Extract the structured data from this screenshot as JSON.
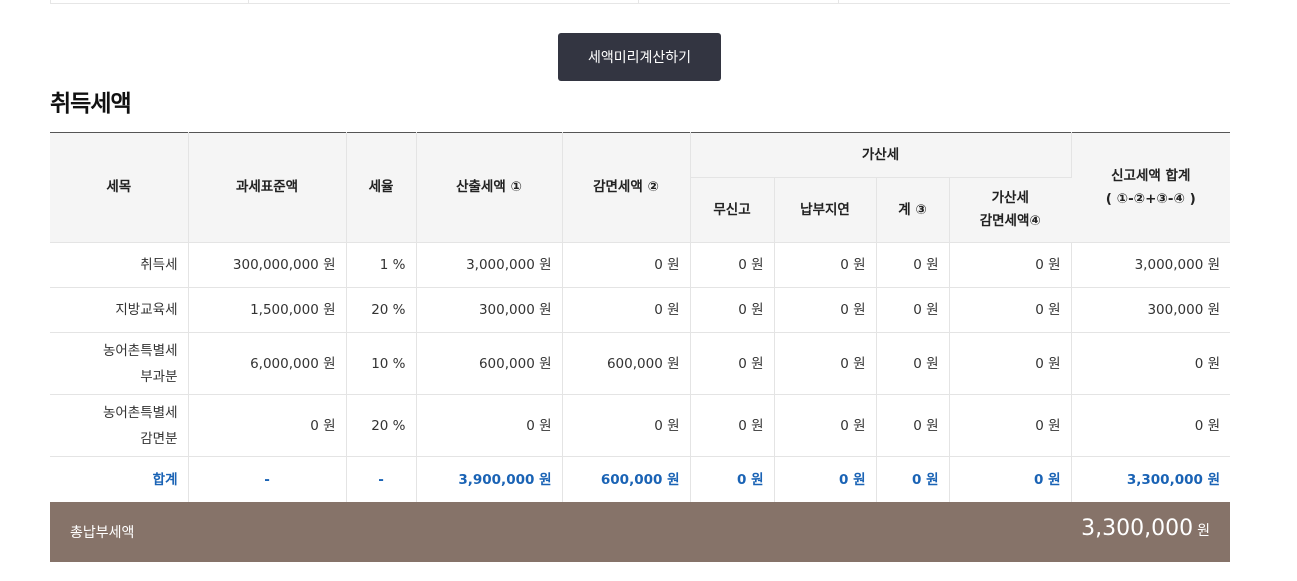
{
  "calc_button": {
    "label": "세액미리계산하기"
  },
  "section": {
    "title": "취득세액"
  },
  "table": {
    "headers": {
      "item": "세목",
      "base": "과세표준액",
      "rate": "세율",
      "computed": "산출세액 ①",
      "reduction": "감면세액 ②",
      "penalty_group": "가산세",
      "no_report": "무신고",
      "late_payment": "납부지연",
      "penalty_sum": "계 ③",
      "penalty_reduction_l1": "가산세",
      "penalty_reduction_l2": "감면세액④",
      "total_l1": "신고세액 합계",
      "total_l2": "( ①-②+③-④ )"
    },
    "rows": [
      {
        "item_l1": "취득세",
        "item_l2": "",
        "base": "300,000,000 원",
        "rate": "1 %",
        "computed": "3,000,000 원",
        "reduction": "0 원",
        "no_report": "0 원",
        "late_payment": "0 원",
        "penalty_sum": "0 원",
        "penalty_reduction": "0 원",
        "total": "3,000,000 원"
      },
      {
        "item_l1": "지방교육세",
        "item_l2": "",
        "base": "1,500,000 원",
        "rate": "20 %",
        "computed": "300,000 원",
        "reduction": "0 원",
        "no_report": "0 원",
        "late_payment": "0 원",
        "penalty_sum": "0 원",
        "penalty_reduction": "0 원",
        "total": "300,000 원"
      },
      {
        "item_l1": "농어촌특별세",
        "item_l2": "부과분",
        "base": "6,000,000 원",
        "rate": "10 %",
        "computed": "600,000 원",
        "reduction": "600,000 원",
        "no_report": "0 원",
        "late_payment": "0 원",
        "penalty_sum": "0 원",
        "penalty_reduction": "0 원",
        "total": "0 원"
      },
      {
        "item_l1": "농어촌특별세",
        "item_l2": "감면분",
        "base": "0 원",
        "rate": "20 %",
        "computed": "0 원",
        "reduction": "0 원",
        "no_report": "0 원",
        "late_payment": "0 원",
        "penalty_sum": "0 원",
        "penalty_reduction": "0 원",
        "total": "0 원"
      }
    ],
    "total_row": {
      "item": "합계",
      "base": "-",
      "rate": "-",
      "computed": "3,900,000 원",
      "reduction": "600,000 원",
      "no_report": "0 원",
      "late_payment": "0 원",
      "penalty_sum": "0 원",
      "penalty_reduction": "0 원",
      "total": "3,300,000 원"
    }
  },
  "grand_total": {
    "label": "총납부세액",
    "value": "3,300,000",
    "unit": "원"
  },
  "colors": {
    "button_bg": "#333541",
    "accent_blue": "#1a63b5",
    "grand_bg": "#867369"
  }
}
